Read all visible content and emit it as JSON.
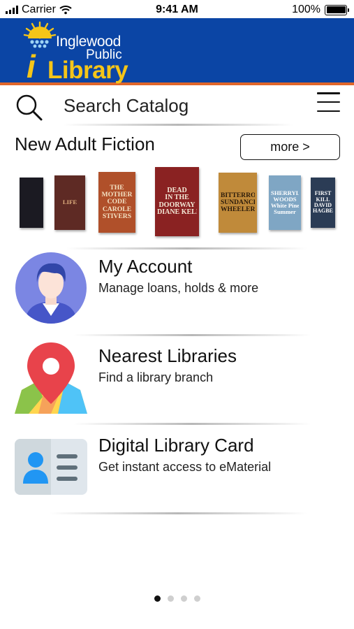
{
  "status_bar": {
    "carrier": "Carrier",
    "time": "9:41 AM",
    "battery": "100%",
    "battery_level": 1.0
  },
  "header": {
    "logo_line1": "Inglewood",
    "logo_line2": "Public",
    "logo_i": "i",
    "logo_library": "Library",
    "colors": {
      "background": "#0b45a5",
      "accent_bar": "#e0662a",
      "logo_yellow": "#f5c518"
    }
  },
  "search": {
    "label": "Search Catalog",
    "icon": "search-icon",
    "menu_icon": "hamburger-menu-icon"
  },
  "new_fiction": {
    "title": "New Adult Fiction",
    "more_label": "more >",
    "books": [
      {
        "name": "book-cover-1",
        "lines": [],
        "bg": "#1b1a22",
        "fg": "#e64a9a"
      },
      {
        "name": "book-cover-2",
        "lines": [
          "LIFE"
        ],
        "bg": "#5e2a24",
        "fg": "#e0b080"
      },
      {
        "name": "book-cover-the-mother-code",
        "lines": [
          "THE",
          "MOTHER",
          "CODE",
          "CAROLE",
          "STIVERS"
        ],
        "bg": "#b0502a",
        "fg": "#f3e2c4"
      },
      {
        "name": "book-cover-dead-in-the-doorway",
        "lines": [
          "DEAD",
          "IN THE",
          "DOORWAY",
          "DIANE KELLY"
        ],
        "bg": "#8a2222",
        "fg": "#f4ead8"
      },
      {
        "name": "book-cover-bitterroot-lawless",
        "lines": [
          "BITTERROOT",
          "SUNDANCE",
          "WHEELER"
        ],
        "bg": "#c08a3a",
        "fg": "#2a1a0a"
      },
      {
        "name": "book-cover-sherryl-woods",
        "lines": [
          "SHERRYL",
          "WOODS",
          "White Pines",
          "Summer"
        ],
        "bg": "#7fa6c4",
        "fg": "#ffffff"
      },
      {
        "name": "book-cover-david-hagberg",
        "lines": [
          "FIRST",
          "KILL",
          "DAVID",
          "HAGBERG"
        ],
        "bg": "#2b3c55",
        "fg": "#ffffff"
      }
    ]
  },
  "features": [
    {
      "name": "my-account",
      "title": "My Account",
      "subtitle": "Manage loans, holds & more",
      "icon": "user-avatar-icon"
    },
    {
      "name": "nearest-libraries",
      "title": "Nearest Libraries",
      "subtitle": "Find a library branch",
      "icon": "map-pin-icon"
    },
    {
      "name": "digital-library-card",
      "title": "Digital Library Card",
      "subtitle": "Get instant access to eMaterial",
      "icon": "id-card-icon"
    }
  ],
  "pagination": {
    "pages": 4,
    "current": 1
  }
}
